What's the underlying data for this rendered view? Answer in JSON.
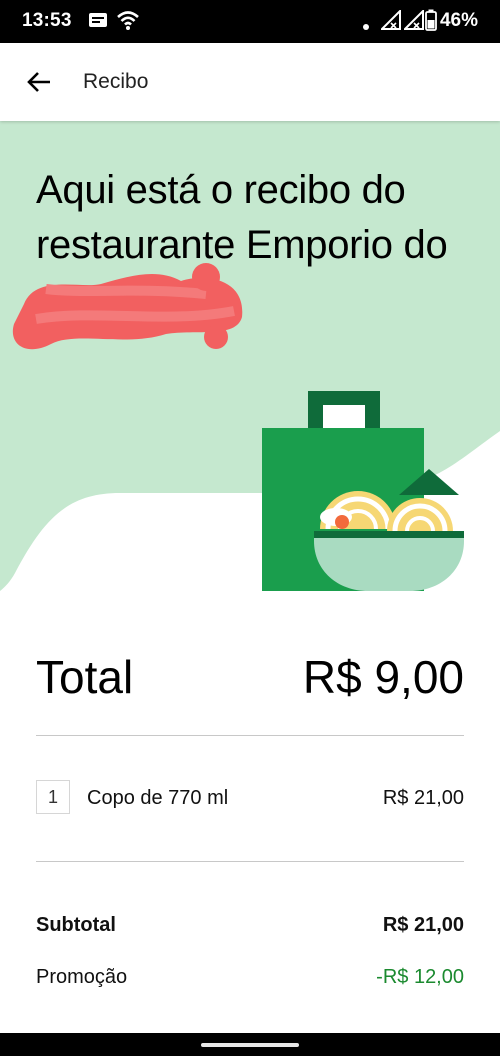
{
  "status_bar": {
    "time": "13:53",
    "battery_percent": "46%",
    "icons": [
      "message-icon",
      "wifi-icon",
      "dot-icon",
      "signal-icon",
      "signal-icon",
      "battery-icon"
    ]
  },
  "appbar": {
    "title": "Recibo",
    "back_icon": "arrow-left-icon"
  },
  "hero": {
    "title": "Aqui está o recibo do restaurante Emporio do Açaí.",
    "background_color": "#c5e8cf",
    "redaction_color": "#f26060",
    "illustration": "shopping-bag-with-noodle-bowl"
  },
  "total": {
    "label": "Total",
    "value": "R$ 9,00"
  },
  "items": [
    {
      "quantity": "1",
      "name": "Copo de 770 ml",
      "price": "R$ 21,00"
    }
  ],
  "summary": {
    "subtotal_label": "Subtotal",
    "subtotal_value": "R$ 21,00",
    "promo_label": "Promoção",
    "promo_value": "-R$ 12,00",
    "promo_color": "#1b8a2f"
  },
  "colors": {
    "bag_green": "#1a9e4d",
    "bag_dark_green": "#0f6b3a",
    "bowl_mint": "#a9dbc1",
    "noodle_yellow": "#f6d774"
  }
}
